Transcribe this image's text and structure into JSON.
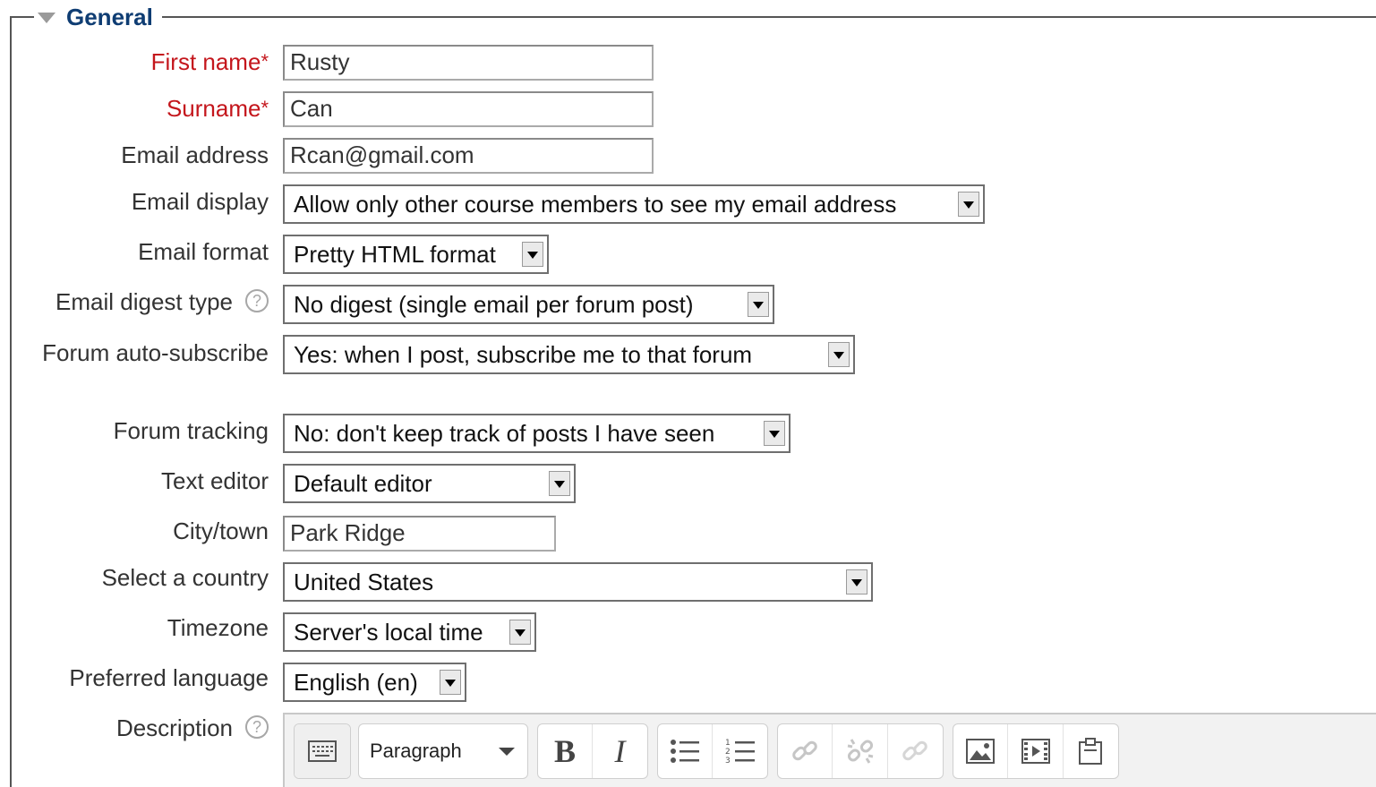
{
  "section": {
    "title": "General"
  },
  "fields": {
    "first_name": {
      "label": "First name",
      "required_mark": "*",
      "value": "Rusty"
    },
    "surname": {
      "label": "Surname",
      "required_mark": "*",
      "value": "Can"
    },
    "email": {
      "label": "Email address",
      "value": "Rcan@gmail.com"
    },
    "email_display": {
      "label": "Email display",
      "selected": "Allow only other course members to see my email address"
    },
    "email_format": {
      "label": "Email format",
      "selected": "Pretty HTML format"
    },
    "email_digest": {
      "label": "Email digest type",
      "help": "?",
      "selected": "No digest (single email per forum post)"
    },
    "forum_autosubscribe": {
      "label": "Forum auto-subscribe",
      "selected": "Yes: when I post, subscribe me to that forum"
    },
    "forum_tracking": {
      "label": "Forum tracking",
      "selected": "No: don't keep track of posts I have seen"
    },
    "text_editor": {
      "label": "Text editor",
      "selected": "Default editor"
    },
    "city": {
      "label": "City/town",
      "value": "Park Ridge"
    },
    "country": {
      "label": "Select a country",
      "selected": "United States"
    },
    "timezone": {
      "label": "Timezone",
      "selected": "Server's local time"
    },
    "language": {
      "label": "Preferred language",
      "selected": "English (en)"
    },
    "description": {
      "label": "Description",
      "help": "?"
    }
  },
  "editor_toolbar": {
    "paragraph_label": "Paragraph",
    "bold_label": "B",
    "italic_label": "I",
    "icons": [
      "toolbar-toggle-icon",
      "bullet-list-icon",
      "numbered-list-icon",
      "link-icon",
      "unlink-icon",
      "anchor-link-icon",
      "image-icon",
      "media-icon",
      "paste-icon"
    ]
  }
}
